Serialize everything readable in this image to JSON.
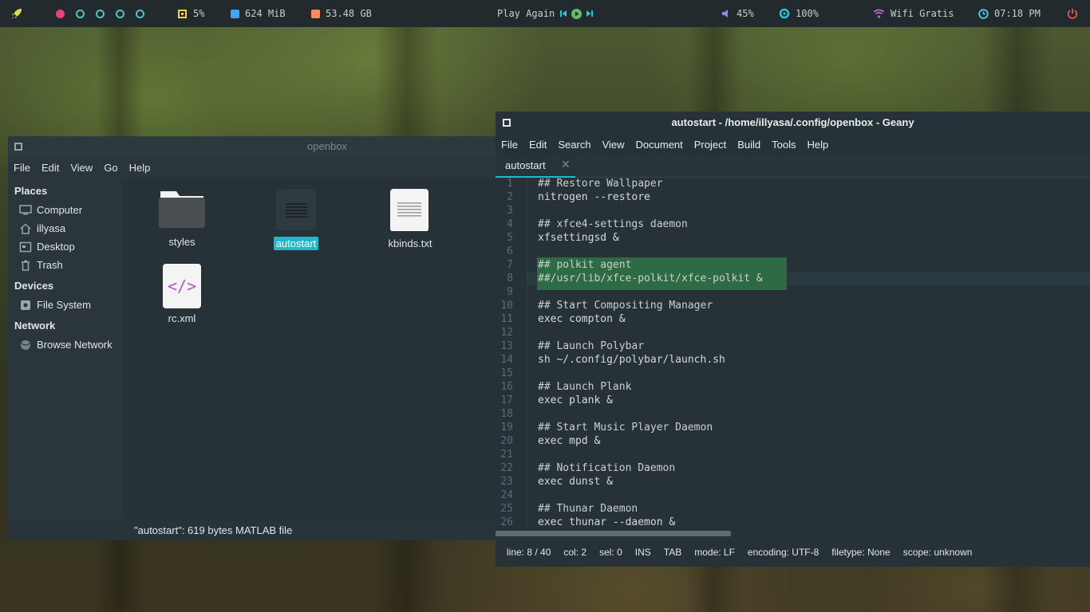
{
  "colors": {
    "bar_bg": "#222a2e",
    "accent_cyan": "#1fb8cc",
    "workspace_active": "#ec407a",
    "workspace_ring": "#4fc3c0",
    "selection_green": "#2e6b44",
    "cpu_yellow": "#f5d44a",
    "ram_blue": "#42a5f5",
    "disk_orange": "#ff8a65",
    "volume_blue": "#7e8ced",
    "brightness_teal": "#26c6da",
    "wifi_purple": "#ba68c8",
    "clock_cyan": "#4dd0e1",
    "power_red": "#ef5350"
  },
  "topbar": {
    "launcher_icon": "rocket-icon",
    "cpu": "5%",
    "ram": "624 MiB",
    "disk": "53.48 GB",
    "music": "Play Again",
    "volume": "45%",
    "brightness": "100%",
    "wifi": "Wifi Gratis",
    "clock": "07:18 PM",
    "power_icon": "power-icon"
  },
  "file_manager": {
    "title": "openbox",
    "menu": [
      "File",
      "Edit",
      "View",
      "Go",
      "Help"
    ],
    "places_header": "Places",
    "places": [
      "Computer",
      "illyasa",
      "Desktop",
      "Trash"
    ],
    "devices_header": "Devices",
    "devices": [
      "File System"
    ],
    "network_header": "Network",
    "network": [
      "Browse Network"
    ],
    "files": [
      {
        "name": "styles",
        "icon": "folder-icon"
      },
      {
        "name": "autostart",
        "icon": "text-file-icon",
        "selected": true
      },
      {
        "name": "kbinds.txt",
        "icon": "text-file-icon"
      },
      {
        "name": "rc.xml",
        "icon": "xml-file-icon"
      }
    ],
    "xml_glyph": "</>",
    "status": "\"autostart\": 619 bytes MATLAB file"
  },
  "geany": {
    "title": "autostart - /home/illyasa/.config/openbox - Geany",
    "menu": [
      "File",
      "Edit",
      "Search",
      "View",
      "Document",
      "Project",
      "Build",
      "Tools",
      "Help"
    ],
    "tab": "autostart",
    "tab_close": "✕",
    "lines": [
      "## Restore Wallpaper",
      "nitrogen --restore",
      "",
      "## xfce4-settings daemon",
      "xfsettingsd &",
      "",
      "## polkit agent",
      "##/usr/lib/xfce-polkit/xfce-polkit &",
      "",
      "## Start Compositing Manager",
      "exec compton &",
      "",
      "## Launch Polybar",
      "sh ~/.config/polybar/launch.sh",
      "",
      "## Launch Plank",
      "exec plank &",
      "",
      "## Start Music Player Daemon",
      "exec mpd &",
      "",
      "## Notification Daemon",
      "exec dunst &",
      "",
      "## Thunar Daemon",
      "exec thunar --daemon &"
    ],
    "line_numbers": [
      "1",
      "2",
      "3",
      "4",
      "5",
      "6",
      "7",
      "8",
      "9",
      "10",
      "11",
      "12",
      "13",
      "14",
      "15",
      "16",
      "17",
      "18",
      "19",
      "20",
      "21",
      "22",
      "23",
      "24",
      "25",
      "26"
    ],
    "status": {
      "line": "line: 8 / 40",
      "col": "col: 2",
      "sel": "sel: 0",
      "ins": "INS",
      "tab": "TAB",
      "mode": "mode: LF",
      "encoding": "encoding: UTF-8",
      "filetype": "filetype: None",
      "scope": "scope: unknown"
    }
  }
}
